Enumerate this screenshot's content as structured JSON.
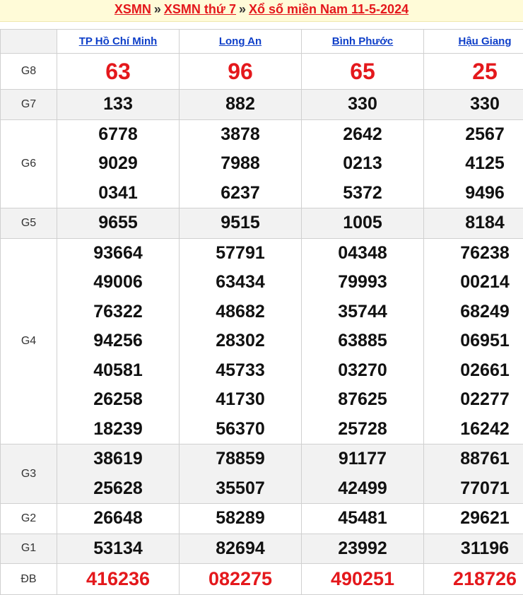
{
  "breadcrumb": {
    "link1": "XSMN",
    "sep1": "»",
    "link2": "XSMN thứ 7",
    "sep2": "»",
    "link3": "Xổ số miền Nam 11-5-2024"
  },
  "provinces": [
    "TP Hồ Chí Minh",
    "Long An",
    "Bình Phước",
    "Hậu Giang"
  ],
  "prizes": [
    {
      "label": "G8",
      "values": [
        [
          "63"
        ],
        [
          "96"
        ],
        [
          "65"
        ],
        [
          "25"
        ]
      ]
    },
    {
      "label": "G7",
      "values": [
        [
          "133"
        ],
        [
          "882"
        ],
        [
          "330"
        ],
        [
          "330"
        ]
      ]
    },
    {
      "label": "G6",
      "values": [
        [
          "6778",
          "9029",
          "0341"
        ],
        [
          "3878",
          "7988",
          "6237"
        ],
        [
          "2642",
          "0213",
          "5372"
        ],
        [
          "2567",
          "4125",
          "9496"
        ]
      ]
    },
    {
      "label": "G5",
      "values": [
        [
          "9655"
        ],
        [
          "9515"
        ],
        [
          "1005"
        ],
        [
          "8184"
        ]
      ]
    },
    {
      "label": "G4",
      "values": [
        [
          "93664",
          "49006",
          "76322",
          "94256",
          "40581",
          "26258",
          "18239"
        ],
        [
          "57791",
          "63434",
          "48682",
          "28302",
          "45733",
          "41730",
          "56370"
        ],
        [
          "04348",
          "79993",
          "35744",
          "63885",
          "03270",
          "87625",
          "25728"
        ],
        [
          "76238",
          "00214",
          "68249",
          "06951",
          "02661",
          "02277",
          "16242"
        ]
      ]
    },
    {
      "label": "G3",
      "values": [
        [
          "38619",
          "25628"
        ],
        [
          "78859",
          "35507"
        ],
        [
          "91177",
          "42499"
        ],
        [
          "88761",
          "77071"
        ]
      ]
    },
    {
      "label": "G2",
      "values": [
        [
          "26648"
        ],
        [
          "58289"
        ],
        [
          "45481"
        ],
        [
          "29621"
        ]
      ]
    },
    {
      "label": "G1",
      "values": [
        [
          "53134"
        ],
        [
          "82694"
        ],
        [
          "23992"
        ],
        [
          "31196"
        ]
      ]
    },
    {
      "label": "ĐB",
      "values": [
        [
          "416236"
        ],
        [
          "082275"
        ],
        [
          "490251"
        ],
        [
          "218726"
        ]
      ]
    }
  ],
  "colors": {
    "accent_red": "#e4181c",
    "link_blue": "#0d3ec8",
    "header_bg": "#fffbd8"
  }
}
